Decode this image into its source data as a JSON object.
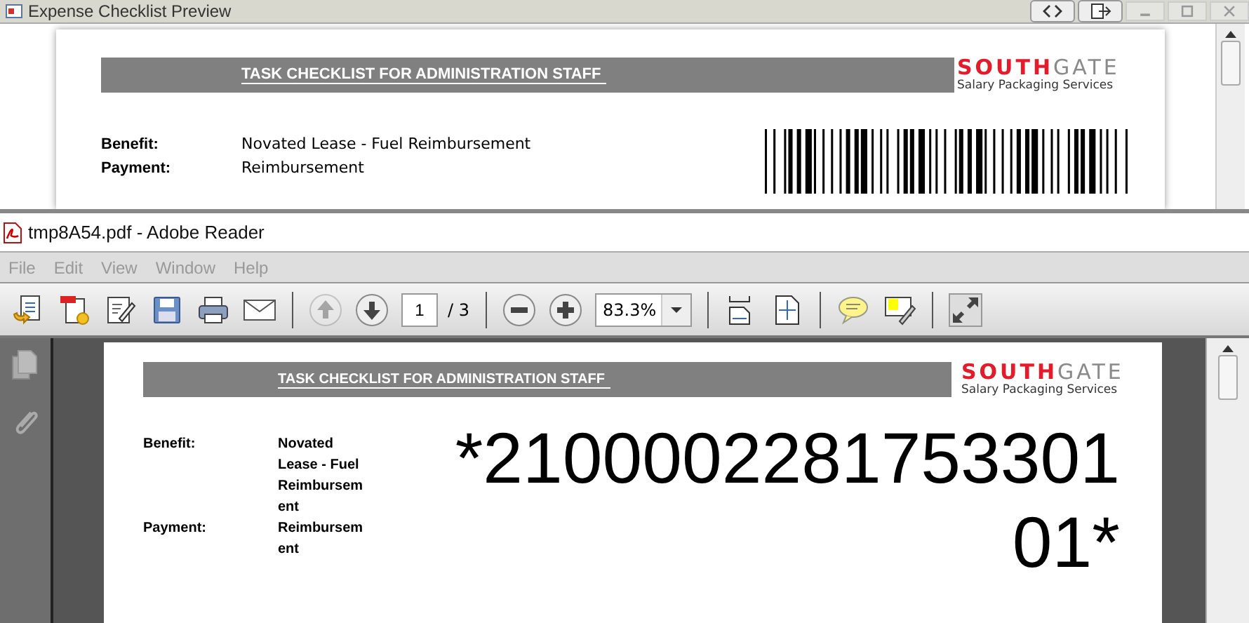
{
  "preview_window": {
    "title": "Expense Checklist Preview",
    "document": {
      "header": "TASK CHECKLIST FOR ADMINISTRATION STAFF",
      "logo": {
        "brand_red": "SOUTH",
        "brand_grey": "GATE",
        "tagline": "Salary Packaging Services"
      },
      "fields": [
        {
          "label": "Benefit:",
          "value": "Novated Lease - Fuel Reimbursement"
        },
        {
          "label": "Payment:",
          "value": "Reimbursement"
        }
      ]
    }
  },
  "reader_window": {
    "title": "tmp8A54.pdf - Adobe Reader",
    "menu": [
      "File",
      "Edit",
      "View",
      "Window",
      "Help"
    ],
    "toolbar": {
      "previous_page": {
        "disabled": true
      },
      "next_page": {
        "disabled": false
      },
      "page_number": "1",
      "page_total": "/ 3",
      "zoom": "83.3%"
    },
    "document": {
      "header": "TASK CHECKLIST  FOR  ADMINISTRATION STAFF",
      "logo": {
        "brand_red": "SOUTH",
        "brand_grey": "GATE",
        "tagline": "Salary Packaging Services"
      },
      "fields": [
        {
          "label": "Benefit:",
          "value": "Novated Lease  - Fuel Reimbursement"
        },
        {
          "label": "Payment:",
          "value": "Reimbursement"
        }
      ],
      "barcode_text": "*210000228175330101*"
    }
  }
}
